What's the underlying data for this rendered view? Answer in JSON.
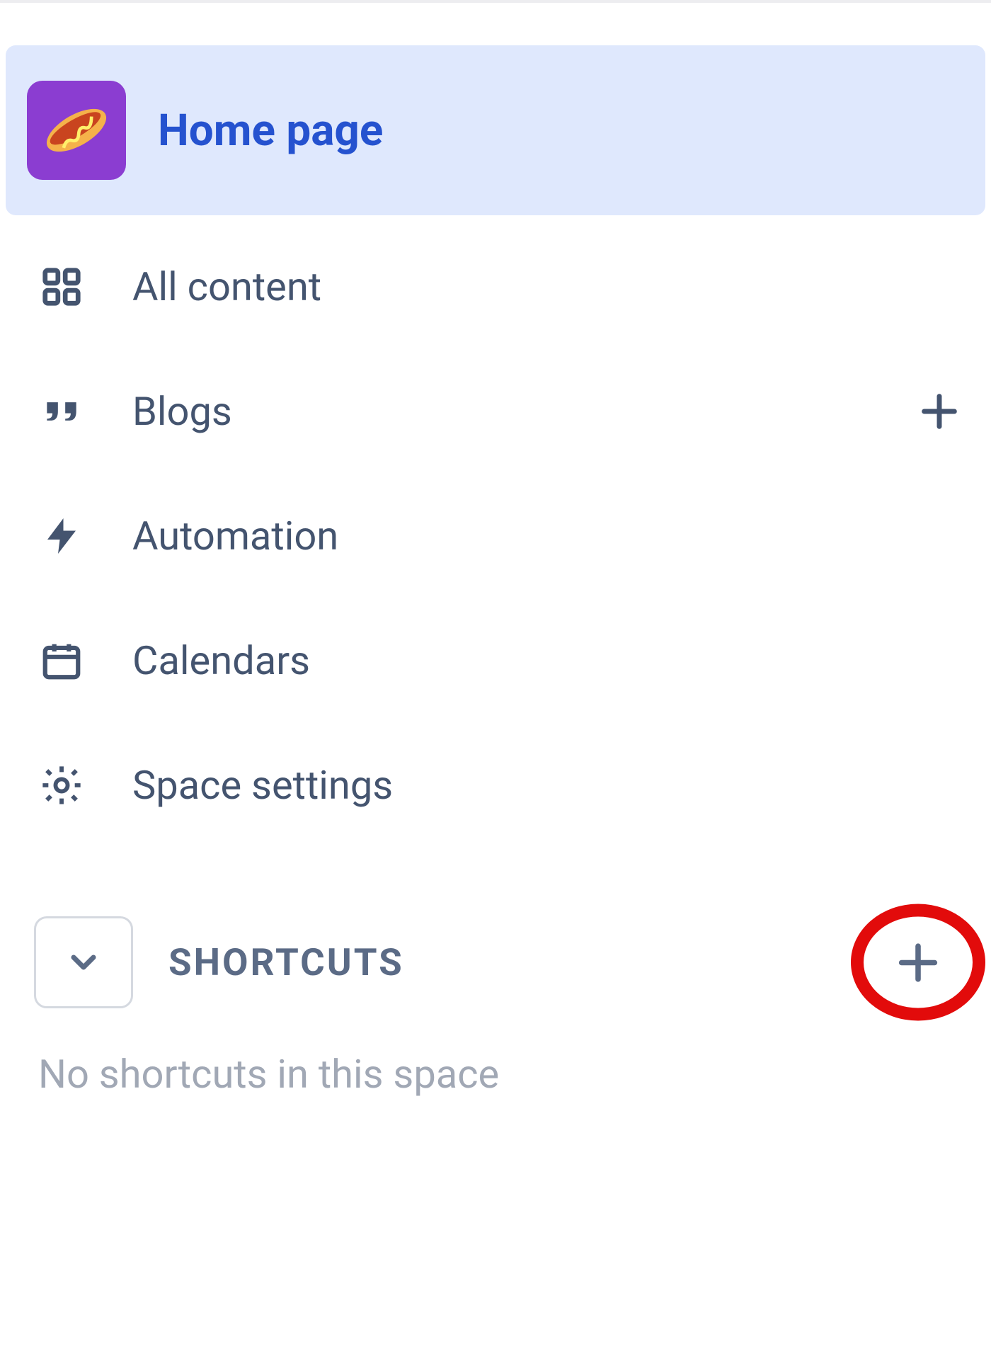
{
  "sidebar": {
    "home": {
      "label": "Home page",
      "icon": "hotdog"
    },
    "items": [
      {
        "label": "All content",
        "icon": "grid",
        "add": false
      },
      {
        "label": "Blogs",
        "icon": "quote",
        "add": true
      },
      {
        "label": "Automation",
        "icon": "bolt",
        "add": false
      },
      {
        "label": "Calendars",
        "icon": "calendar",
        "add": false
      },
      {
        "label": "Space settings",
        "icon": "gear",
        "add": false
      }
    ]
  },
  "shortcuts": {
    "title": "SHORTCUTS",
    "empty_text": "No shortcuts in this space"
  }
}
